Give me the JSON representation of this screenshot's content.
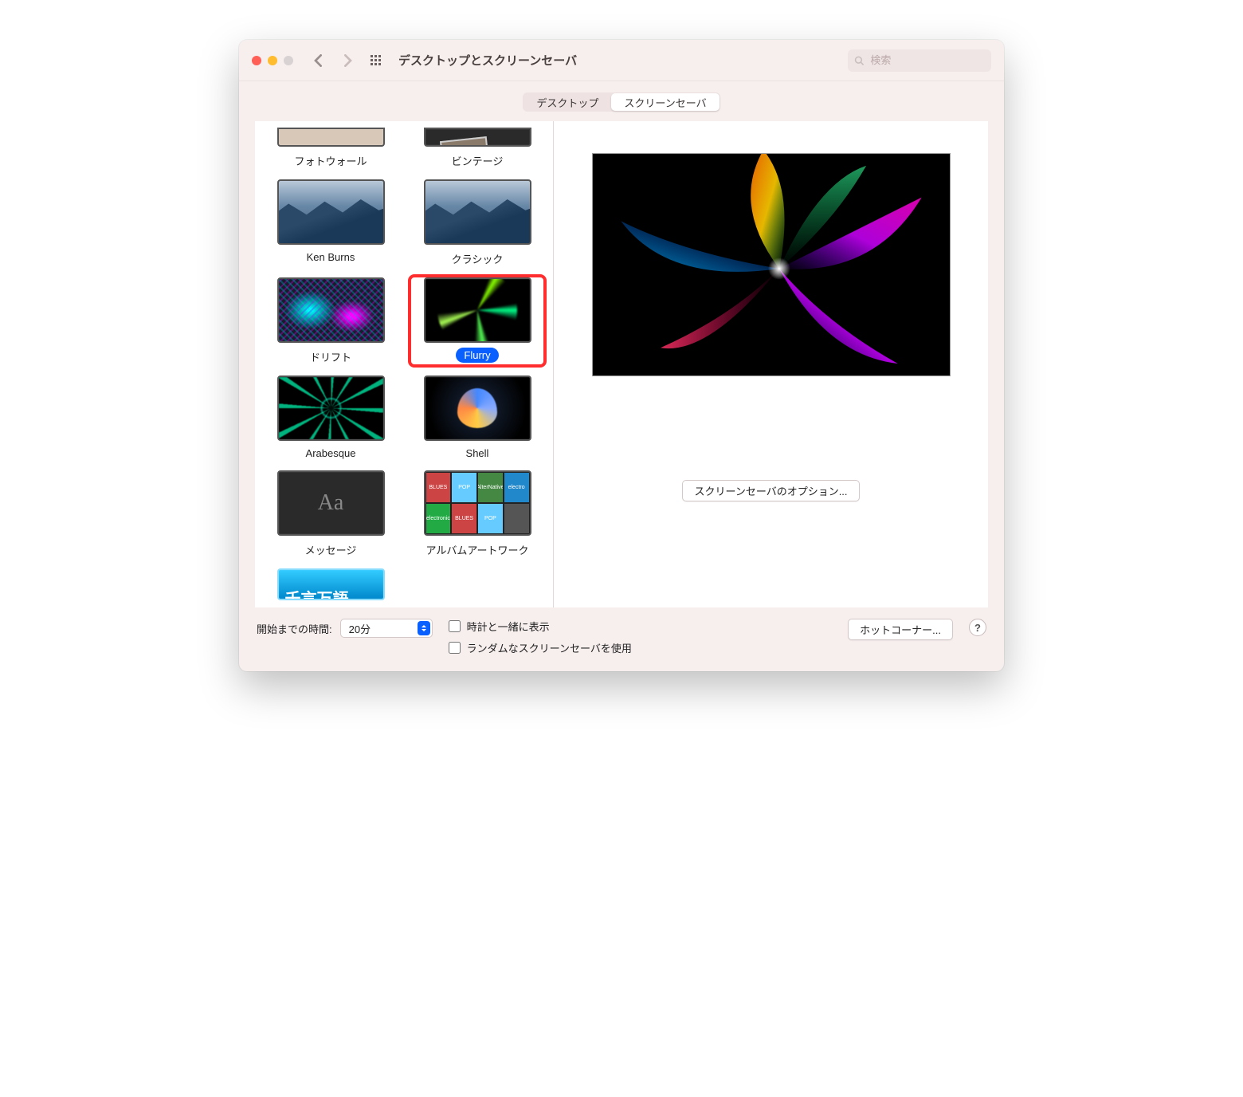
{
  "window": {
    "title": "デスクトップとスクリーンセーバ",
    "search_placeholder": "検索"
  },
  "tabs": {
    "desktop": "デスクトップ",
    "screensaver": "スクリーンセーバ"
  },
  "savers": {
    "photowall": "フォトウォール",
    "vintage": "ビンテージ",
    "kenburns": "Ken Burns",
    "classic": "クラシック",
    "drift": "ドリフト",
    "flurry": "Flurry",
    "arabesque": "Arabesque",
    "shell": "Shell",
    "message": "メッセージ",
    "album": "アルバムアートワーク",
    "wotd": "千言万語"
  },
  "preview": {
    "options_button": "スクリーンセーバのオプション..."
  },
  "bottom": {
    "start_label": "開始までの時間:",
    "start_value": "20分",
    "clock_label": "時計と一緒に表示",
    "random_label": "ランダムなスクリーンセーバを使用",
    "hotcorners": "ホットコーナー...",
    "help": "?"
  }
}
